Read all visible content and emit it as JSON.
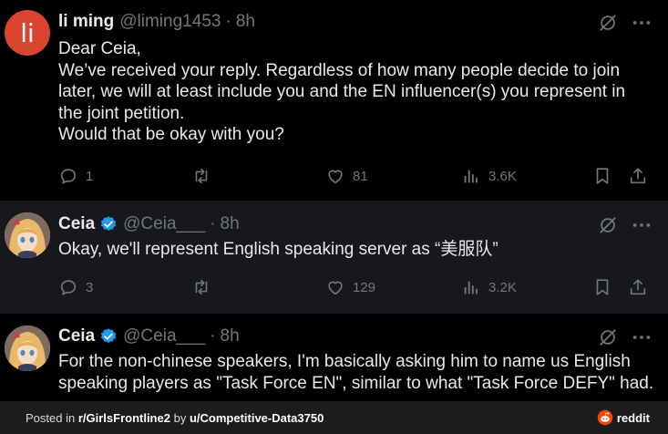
{
  "tweets": [
    {
      "avatar_letter": "li",
      "name": "li ming",
      "handle": "@liming1453",
      "separator": "·",
      "time": "8h",
      "verified": false,
      "lines": [
        "Dear Ceia,",
        "We’ve received your reply. Regardless of how many people decide to join",
        "later, we will at least include you and the EN influencer(s) you represent in",
        "the joint petition.",
        "Would that be okay with you?"
      ],
      "replies": "1",
      "reposts": "",
      "likes": "81",
      "views": "3.6K"
    },
    {
      "name": "Ceia",
      "handle": "@Ceia___",
      "separator": "·",
      "time": "8h",
      "verified": true,
      "lines": [
        "Okay, we'll represent English speaking server as “美服队”"
      ],
      "replies": "3",
      "reposts": "",
      "likes": "129",
      "views": "3.2K"
    },
    {
      "name": "Ceia",
      "handle": "@Ceia___",
      "separator": "·",
      "time": "8h",
      "verified": true,
      "lines": [
        "For the non-chinese speakers, I'm basically asking him to name us English",
        "speaking players as \"Task Force EN\", similar to what \"Task Force DEFY\" had."
      ]
    }
  ],
  "footer": {
    "posted_in": "Posted in",
    "subreddit": "r/GirlsFrontline2",
    "by": "by",
    "user": "u/Competitive-Data3750",
    "brand": "reddit"
  },
  "colors": {
    "background": "#000000",
    "highlight_background": "#16181c",
    "text": "#e7e9ea",
    "muted": "#71767b",
    "verified_blue": "#1d9bf0",
    "avatar_red": "#d9452e",
    "reddit_orange": "#ff4500"
  }
}
